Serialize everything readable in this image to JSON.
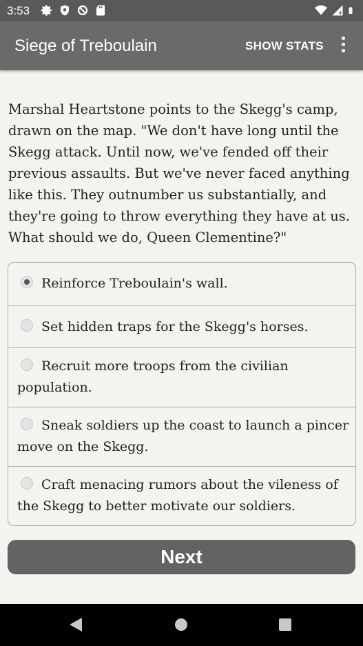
{
  "status_bar": {
    "time": "3:53",
    "left_icons": [
      "gear-icon",
      "shield-icon",
      "no-sync-icon",
      "sd-card-icon"
    ],
    "right_icons": [
      "wifi-icon",
      "signal-icon",
      "battery-icon"
    ]
  },
  "app_bar": {
    "title": "Siege of Treboulain",
    "show_stats_label": "SHOW STATS",
    "overflow_icon": "more-vert-icon"
  },
  "story": {
    "text": "Marshal Heartstone points to the Skegg's camp, drawn on the map. \"We don't have long until the Skegg attack. Until now, we've fended off their previous assaults. But we've never faced anything like this. They outnumber us substantially, and they're going to throw everything they have at us. What should we do, Queen Clementine?\""
  },
  "choices": [
    {
      "label": "Reinforce Treboulain's wall.",
      "selected": true
    },
    {
      "label": "Set hidden traps for the Skegg's horses.",
      "selected": false
    },
    {
      "label": "Recruit more troops from the civilian population.",
      "selected": false
    },
    {
      "label": "Sneak soldiers up the coast to launch a pincer move on the Skegg.",
      "selected": false
    },
    {
      "label": "Craft menacing rumors about the vileness of the Skegg to better motivate our soldiers.",
      "selected": false
    }
  ],
  "next_button": {
    "label": "Next"
  },
  "nav_bar": {
    "icons": [
      "back-icon",
      "home-icon",
      "recents-icon"
    ]
  },
  "colors": {
    "status_bar": "#595959",
    "app_bar": "#6a6a6a",
    "background": "#f5f3ef",
    "button": "#636363",
    "nav_bar": "#000000"
  }
}
